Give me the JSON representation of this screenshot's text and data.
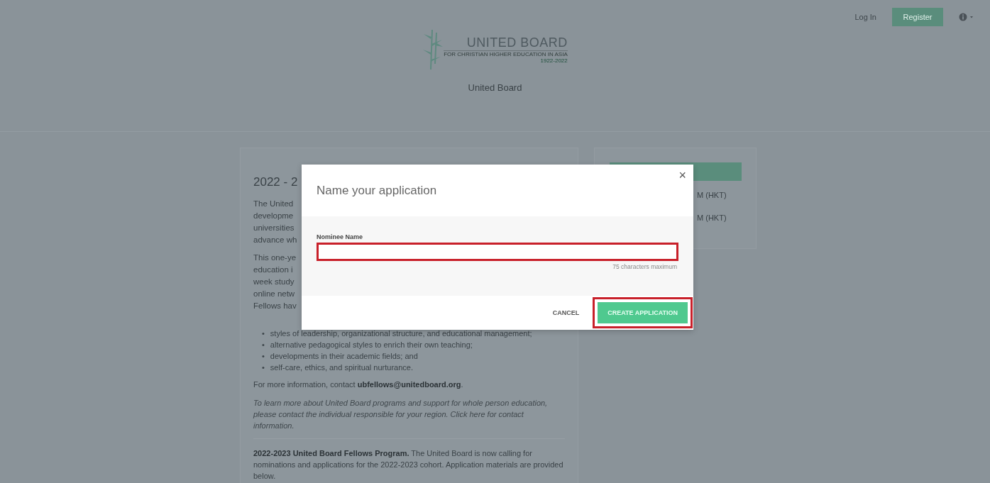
{
  "nav": {
    "login": "Log In",
    "register": "Register"
  },
  "header": {
    "logo_name": "UNITED BOARD",
    "logo_tagline": "FOR CHRISTIAN HIGHER EDUCATION IN ASIA",
    "logo_years": "1922-2022",
    "org_name": "United Board"
  },
  "main_card": {
    "title_fragment": "2022 - 2",
    "paragraph_fragments": [
      [
        "The United",
        "developme",
        "universities",
        "advance wh"
      ],
      [
        "This one-ye",
        "education i",
        "week study",
        "online netw",
        "Fellows hav"
      ]
    ],
    "bullets": [
      {
        "marker": "•",
        "text": "styles of leadership, organizational structure, and educational management;"
      },
      {
        "marker": "•",
        "text": "alternative pedagogical styles to enrich their own teaching;"
      },
      {
        "marker": "•",
        "text": "developments in their academic fields; and"
      },
      {
        "marker": "•",
        "text": "self-care, ethics, and spiritual nurturance."
      }
    ],
    "contact": "For more information, contact **ubfellows@unitedboard.org**.",
    "note": "To learn more about United Board programs and support for whole person education, please contact the individual responsible for your region. Click here for contact information.",
    "announcement": "**2022-2023 United Board Fellows Program.** The United Board is now calling for nominations and applications for the 2022-2023 cohort. Application materials are provided below."
  },
  "side_card": {
    "date_fragments": [
      "M (HKT)",
      "M (HKT)"
    ]
  },
  "modal": {
    "title": "Name your application",
    "close": "×",
    "field": {
      "label": "Nominee Name",
      "hint": "75 characters maximum",
      "highlighted": true
    },
    "buttons": [
      {
        "kind": "cancel",
        "label": "CANCEL",
        "highlighted": false
      },
      {
        "kind": "primary",
        "label": "CREATE APPLICATION",
        "highlighted": true
      }
    ]
  }
}
